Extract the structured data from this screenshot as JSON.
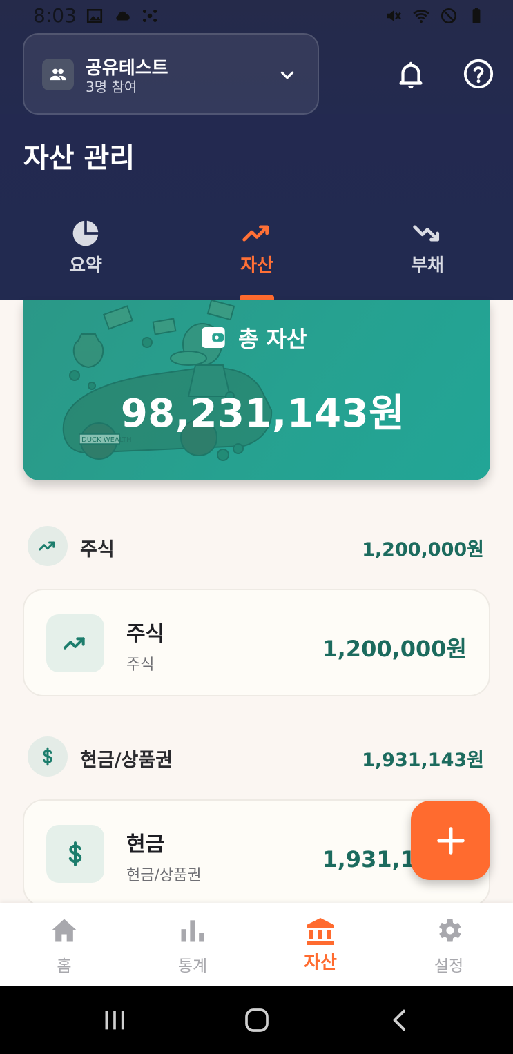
{
  "status_bar": {
    "time": "8:03"
  },
  "header": {
    "group": {
      "name": "공유테스트",
      "members": "3명 참여"
    },
    "title": "자산 관리"
  },
  "tabs": [
    {
      "label": "요약",
      "icon": "pie-chart-icon",
      "active": false
    },
    {
      "label": "자산",
      "icon": "trending-up-icon",
      "active": true
    },
    {
      "label": "부채",
      "icon": "trending-down-icon",
      "active": false
    }
  ],
  "total": {
    "label": "총 자산",
    "value": "98,231,143원",
    "art_text": "DUCK WEALTH"
  },
  "sections": [
    {
      "title": "주식",
      "amount": "1,200,000원",
      "icon": "trending-up-icon",
      "items": [
        {
          "name": "주식",
          "category": "주식",
          "amount": "1,200,000원",
          "icon": "trending-up-icon"
        }
      ]
    },
    {
      "title": "현금/상품권",
      "amount": "1,931,143원",
      "icon": "dollar-icon",
      "items": [
        {
          "name": "현금",
          "category": "현금/상품권",
          "amount": "1,931,143원",
          "icon": "dollar-icon"
        }
      ]
    }
  ],
  "bottom_nav": [
    {
      "label": "홈",
      "icon": "home-icon",
      "active": false
    },
    {
      "label": "통계",
      "icon": "bar-chart-icon",
      "active": false
    },
    {
      "label": "자산",
      "icon": "bank-icon",
      "active": true
    },
    {
      "label": "설정",
      "icon": "gear-icon",
      "active": false
    }
  ],
  "colors": {
    "header_bg": "#232950",
    "accent": "#ff6b2f",
    "teal": "#26a190",
    "amount_text": "#1c6b5e",
    "page_bg": "#fbf6f2"
  }
}
